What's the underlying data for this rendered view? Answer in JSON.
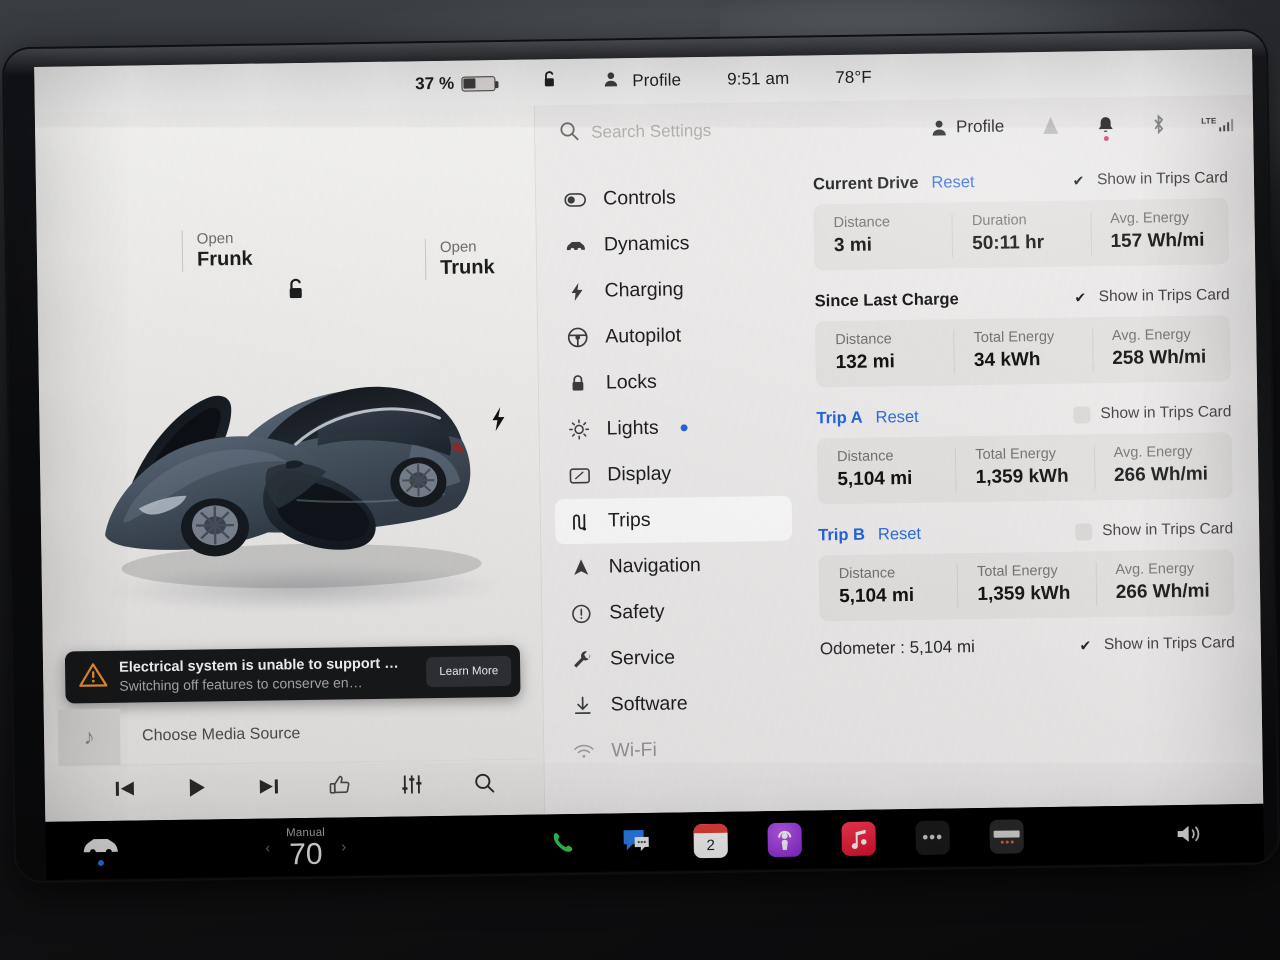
{
  "statusbar": {
    "battery_percent": "37 %",
    "battery_level": 37,
    "lock_icon": "unlock-icon",
    "profile_label": "Profile",
    "time": "9:51 am",
    "temperature": "78°F"
  },
  "left_pane": {
    "frunk": {
      "action": "Open",
      "target": "Frunk"
    },
    "trunk": {
      "action": "Open",
      "target": "Trunk"
    },
    "unlock_icon": "unlock-icon",
    "charge_port_icon": "charge-bolt-icon",
    "alert": {
      "title": "Electrical system is unable to support …",
      "subtitle": "Switching off features to conserve en…",
      "button": "Learn More",
      "icon": "warning-triangle-icon",
      "accent": "#e8912f"
    },
    "media": {
      "source_label": "Choose Media Source",
      "art_icon": "music-note-icon",
      "controls": [
        {
          "name": "previous-track-button",
          "icon": "skip-back-icon"
        },
        {
          "name": "play-button",
          "icon": "play-icon"
        },
        {
          "name": "next-track-button",
          "icon": "skip-forward-icon"
        },
        {
          "name": "like-button",
          "icon": "thumbs-up-icon"
        },
        {
          "name": "equalizer-button",
          "icon": "sliders-icon"
        },
        {
          "name": "media-search-button",
          "icon": "search-icon"
        }
      ]
    }
  },
  "settings": {
    "search": {
      "placeholder": "Search Settings",
      "value": "",
      "icon": "search-icon"
    },
    "header": {
      "profile_label": "Profile",
      "icons": [
        "wiper-icon",
        "bell-icon",
        "bluetooth-icon",
        "lte-signal-icon"
      ],
      "lte_label": "LTE",
      "bell_badge": true
    },
    "sidebar": [
      {
        "label": "Controls",
        "icon": "toggle-icon",
        "active": false,
        "badge": false
      },
      {
        "label": "Dynamics",
        "icon": "car-front-icon",
        "active": false,
        "badge": false
      },
      {
        "label": "Charging",
        "icon": "bolt-icon",
        "active": false,
        "badge": false
      },
      {
        "label": "Autopilot",
        "icon": "steering-wheel-icon",
        "active": false,
        "badge": false
      },
      {
        "label": "Locks",
        "icon": "padlock-icon",
        "active": false,
        "badge": false
      },
      {
        "label": "Lights",
        "icon": "light-sun-icon",
        "active": false,
        "badge": true
      },
      {
        "label": "Display",
        "icon": "display-icon",
        "active": false,
        "badge": false
      },
      {
        "label": "Trips",
        "icon": "trips-road-icon",
        "active": true,
        "badge": false
      },
      {
        "label": "Navigation",
        "icon": "nav-arrow-icon",
        "active": false,
        "badge": false
      },
      {
        "label": "Safety",
        "icon": "exclamation-circle-icon",
        "active": false,
        "badge": false
      },
      {
        "label": "Service",
        "icon": "wrench-icon",
        "active": false,
        "badge": false
      },
      {
        "label": "Software",
        "icon": "download-icon",
        "active": false,
        "badge": false
      },
      {
        "label": "Wi-Fi",
        "icon": "wifi-icon",
        "active": false,
        "badge": false
      }
    ],
    "show_in_trips_card_label": "Show in Trips Card",
    "reset_label": "Reset",
    "sections": [
      {
        "title": "Current Drive",
        "title_is_link": false,
        "has_reset": true,
        "checked": true,
        "stats": [
          {
            "key": "Distance",
            "value": "3 mi"
          },
          {
            "key": "Duration",
            "value": "50:11 hr"
          },
          {
            "key": "Avg. Energy",
            "value": "157 Wh/mi"
          }
        ]
      },
      {
        "title": "Since Last Charge",
        "title_is_link": false,
        "has_reset": false,
        "checked": true,
        "stats": [
          {
            "key": "Distance",
            "value": "132 mi"
          },
          {
            "key": "Total Energy",
            "value": "34 kWh"
          },
          {
            "key": "Avg. Energy",
            "value": "258 Wh/mi"
          }
        ]
      },
      {
        "title": "Trip A",
        "title_is_link": true,
        "has_reset": true,
        "checked": false,
        "stats": [
          {
            "key": "Distance",
            "value": "5,104 mi"
          },
          {
            "key": "Total Energy",
            "value": "1,359 kWh"
          },
          {
            "key": "Avg. Energy",
            "value": "266 Wh/mi"
          }
        ]
      },
      {
        "title": "Trip B",
        "title_is_link": true,
        "has_reset": true,
        "checked": false,
        "stats": [
          {
            "key": "Distance",
            "value": "5,104 mi"
          },
          {
            "key": "Total Energy",
            "value": "1,359 kWh"
          },
          {
            "key": "Avg. Energy",
            "value": "266 Wh/mi"
          }
        ]
      }
    ],
    "odometer": {
      "text": "Odometer : 5,104 mi",
      "checked": true
    }
  },
  "dock": {
    "car_icon": "car-front-icon",
    "climate": {
      "mode": "Manual",
      "temperature": "70",
      "left_arrow": "‹",
      "right_arrow": "›"
    },
    "apps": [
      {
        "name": "phone-app",
        "label": "",
        "icon": "phone-icon"
      },
      {
        "name": "messages-app",
        "label": "",
        "icon": "message-bubble-icon"
      },
      {
        "name": "calendar-app",
        "label": "2",
        "icon": "calendar-icon"
      },
      {
        "name": "podcasts-app",
        "label": "",
        "icon": "podcast-icon"
      },
      {
        "name": "music-app",
        "label": "",
        "icon": "music-note-icon"
      },
      {
        "name": "more-apps",
        "label": "•••",
        "icon": "ellipsis-icon"
      },
      {
        "name": "dashcam-app",
        "label": "",
        "icon": "dashcam-icon"
      }
    ],
    "volume_icon": "speaker-icon"
  },
  "colors": {
    "accent_blue": "#2464d8",
    "alert_bg": "#17181a",
    "warning_orange": "#e8912f",
    "screen_bg": "#f2f1f0",
    "card_bg": "#e3e1df"
  }
}
